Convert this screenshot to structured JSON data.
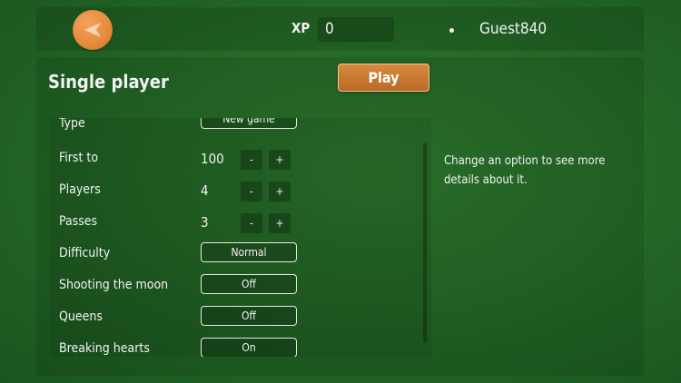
{
  "header": {
    "back_icon": "back-arrow-icon",
    "xp_label": "XP",
    "xp_value": "0",
    "username": "Guest840"
  },
  "panel": {
    "title": "Single player",
    "play_label": "Play",
    "help_text": "Change an option to see more details about it."
  },
  "options": {
    "type": {
      "label": "Type",
      "value": "New game"
    },
    "first_to": {
      "label": "First to",
      "value": "100",
      "minus": "-",
      "plus": "+"
    },
    "players": {
      "label": "Players",
      "value": "4",
      "minus": "-",
      "plus": "+"
    },
    "passes": {
      "label": "Passes",
      "value": "3",
      "minus": "-",
      "plus": "+"
    },
    "difficulty": {
      "label": "Difficulty",
      "value": "Normal"
    },
    "shooting_the_moon": {
      "label": "Shooting the moon",
      "value": "Off"
    },
    "queens": {
      "label": "Queens",
      "value": "Off"
    },
    "breaking_hearts": {
      "label": "Breaking hearts",
      "value": "On"
    }
  },
  "colors": {
    "felt_green": "#256a27",
    "accent_orange": "#e58a3c",
    "play_button": "#c97a30"
  }
}
